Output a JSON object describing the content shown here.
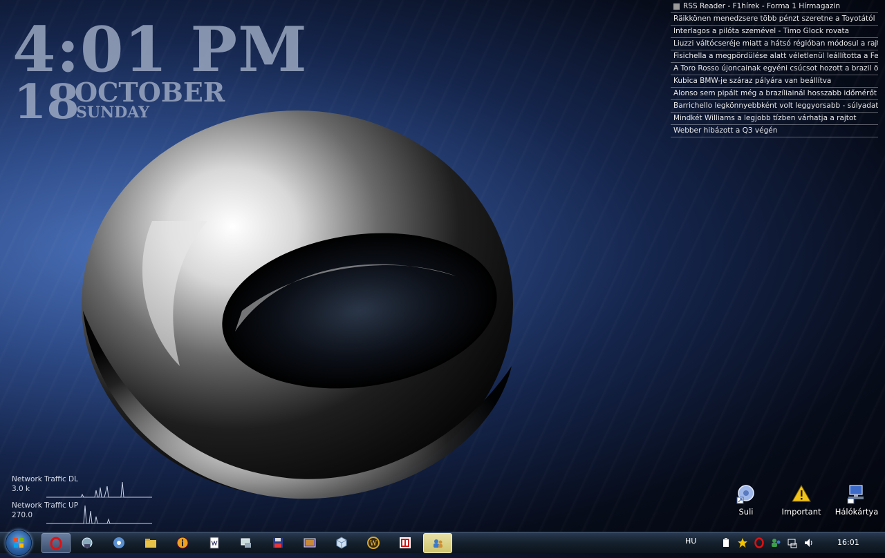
{
  "clock": {
    "time": "4:01 PM",
    "day": "18",
    "month": "OCTOBER",
    "weekday": "SUNDAY"
  },
  "rss": {
    "title": "RSS Reader - F1hírek - Forma 1 Hírmagazin",
    "items": [
      "Räikkönen menedzsere több pénzt szeretne a Toyotától",
      "Interlagos a pilóta szemével - Timo Glock rovata",
      "Liuzzi váltócseréje miatt a hátsó régióban módosul a rajtrács",
      "Fisichella a megpördülése alatt véletlenül leállította a Ferrarit",
      "A Toro Rosso újoncainak egyéni csúcsot hozott a brazil özönvíz",
      "Kubica BMW-je száraz pályára van beállítva",
      "Alonso sem pipált még a brazíliainál hosszabb időmérőt",
      "Barrichello legkönnyebbként volt leggyorsabb - súlyadatok",
      "Mindkét Williams a legjobb tízben várhatja a rajtot",
      "Webber hibázott a Q3 végén"
    ]
  },
  "network": {
    "dl_label": "Network Traffic DL",
    "dl_value": "3.0 k",
    "up_label": "Network Traffic UP",
    "up_value": "270.0"
  },
  "desktop_icons": [
    {
      "label": "Suli",
      "icon": "shortcut-folder-icon"
    },
    {
      "label": "Important",
      "icon": "warning-icon"
    },
    {
      "label": "Hálókártya",
      "icon": "network-icon"
    }
  ],
  "taskbar": {
    "language": "HU",
    "clock": "16:01",
    "apps": [
      "opera",
      "network-tool",
      "media-player",
      "explorer",
      "info-app",
      "word-app",
      "monitor-app",
      "floppy-app",
      "image-app",
      "cube-app",
      "warcraft-app",
      "ti-app",
      "users-app"
    ]
  },
  "colors": {
    "accent": "#2d4a86",
    "taskbar": "#16222f",
    "clock_text": "#a0acc4"
  }
}
